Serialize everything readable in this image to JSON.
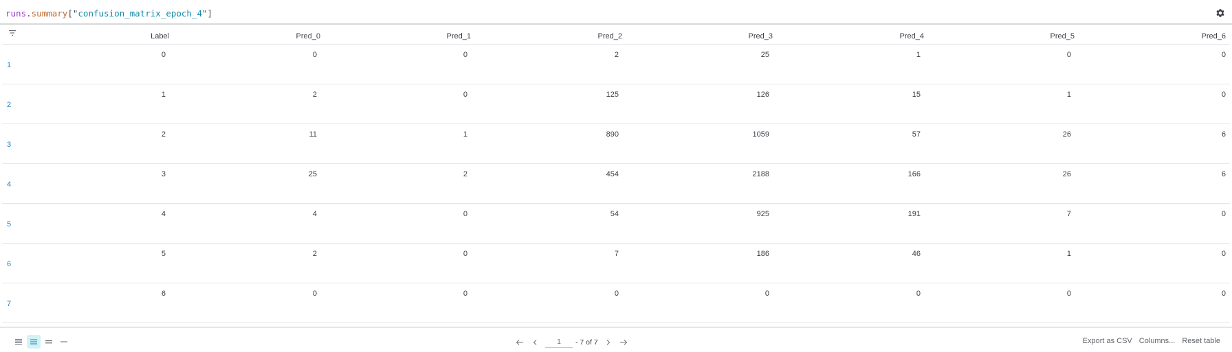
{
  "query": {
    "object": "runs",
    "dot": ".",
    "property": "summary",
    "open_bracket": "[\"",
    "key": "confusion_matrix_epoch_4",
    "close_bracket": "\"]"
  },
  "table": {
    "columns": [
      "Label",
      "Pred_0",
      "Pred_1",
      "Pred_2",
      "Pred_3",
      "Pred_4",
      "Pred_5",
      "Pred_6"
    ],
    "rows": [
      {
        "index": "1",
        "cells": [
          "0",
          "0",
          "0",
          "2",
          "25",
          "1",
          "0",
          "0"
        ]
      },
      {
        "index": "2",
        "cells": [
          "1",
          "2",
          "0",
          "125",
          "126",
          "15",
          "1",
          "0"
        ]
      },
      {
        "index": "3",
        "cells": [
          "2",
          "11",
          "1",
          "890",
          "1059",
          "57",
          "26",
          "6"
        ]
      },
      {
        "index": "4",
        "cells": [
          "3",
          "25",
          "2",
          "454",
          "2188",
          "166",
          "26",
          "6"
        ]
      },
      {
        "index": "5",
        "cells": [
          "4",
          "4",
          "0",
          "54",
          "925",
          "191",
          "7",
          "0"
        ]
      },
      {
        "index": "6",
        "cells": [
          "5",
          "2",
          "0",
          "7",
          "186",
          "46",
          "1",
          "0"
        ]
      },
      {
        "index": "7",
        "cells": [
          "6",
          "0",
          "0",
          "0",
          "0",
          "0",
          "0",
          "0"
        ]
      }
    ]
  },
  "footer": {
    "page_input_placeholder": "1",
    "page_total": "- 7 of 7",
    "export_label": "Export as CSV",
    "columns_label": "Columns...",
    "reset_label": "Reset table"
  },
  "colors": {
    "accent": "#1f86c7",
    "active_density": "#d3f2f6"
  }
}
